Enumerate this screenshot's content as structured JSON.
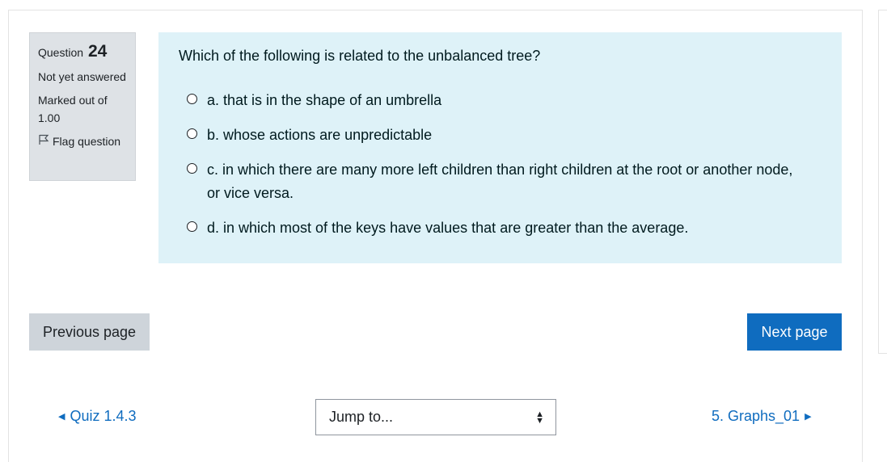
{
  "question_info": {
    "label": "Question",
    "number": "24",
    "state": "Not yet answered",
    "grade": "Marked out of 1.00",
    "flag_label": "Flag question"
  },
  "question": {
    "text": "Which of the following is related to the unbalanced tree?",
    "answers": [
      {
        "label": "a. that is in the shape of an umbrella"
      },
      {
        "label": "b. whose actions are unpredictable"
      },
      {
        "label": "c. in which there are many more left children than right children at the root or another node, or vice versa."
      },
      {
        "label": "d. in which most of the keys have values that are greater than the average."
      }
    ]
  },
  "nav": {
    "previous_page": "Previous page",
    "next_page": "Next page",
    "prev_activity": "Quiz 1.4.3",
    "next_activity": "5. Graphs_01",
    "jump_placeholder": "Jump to..."
  },
  "icons": {
    "flag": "flag-icon",
    "prev_arrow": "left-arrow-icon",
    "next_arrow": "right-arrow-icon",
    "select": "updown-icon"
  },
  "colors": {
    "primary": "#0f6cbf",
    "content_bg": "#def2f8",
    "info_bg": "#dee2e6",
    "secondary_btn": "#ced4da"
  }
}
